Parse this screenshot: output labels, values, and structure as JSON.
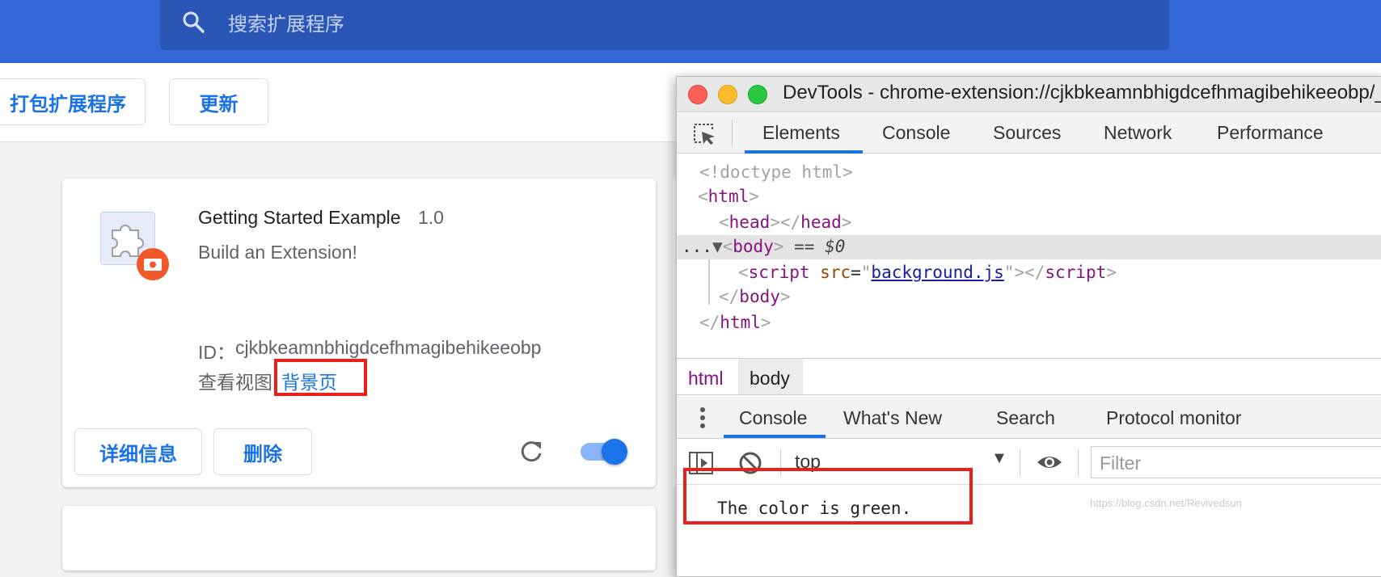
{
  "search": {
    "placeholder": "搜索扩展程序"
  },
  "toolbar": {
    "pack_label": "打包扩展程序",
    "update_label": "更新"
  },
  "extension": {
    "name": "Getting Started Example",
    "version": "1.0",
    "description": "Build an Extension!",
    "id_label": "ID：",
    "id": "cjkbkeamnbhigdcefhmagibehikeeobp",
    "views_label": "查看视图",
    "background_link": "背景页",
    "details_label": "详细信息",
    "remove_label": "删除",
    "enabled": true
  },
  "devtools": {
    "title": "DevTools - chrome-extension://cjkbkeamnbhigdcefhmagibehikeeobp/_generated_background_page.html",
    "tabs": [
      "Elements",
      "Console",
      "Sources",
      "Network",
      "Performance"
    ],
    "active_tab": "Elements",
    "dom": {
      "doctype": "<!doctype html>",
      "html": "html",
      "head": "head",
      "body": "body",
      "selected_marker": "== $0",
      "ellipsis": "...",
      "script_tag": "script",
      "src_attr": "src",
      "src_value": "background.js"
    },
    "breadcrumbs": [
      "html",
      "body"
    ],
    "drawer_tabs": [
      "Console",
      "What's New",
      "Search",
      "Protocol monitor"
    ],
    "context": "top",
    "filter_placeholder": "Filter",
    "console_messages": [
      "The color is green."
    ]
  },
  "watermark": "https://blog.csdn.net/Revivedsun",
  "colors": {
    "accent": "#1a73e8",
    "header": "#3367d6",
    "highlight": "#e8221b"
  }
}
